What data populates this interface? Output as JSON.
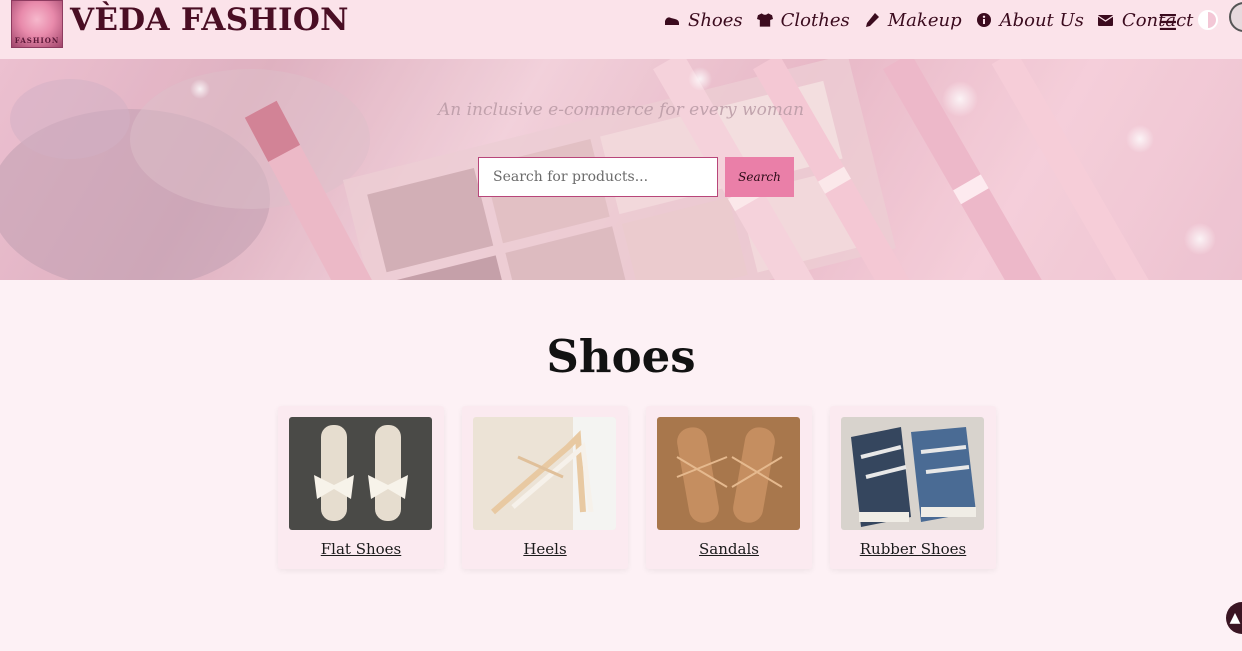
{
  "brand": {
    "name": "VÈDA FASHION",
    "logo_text": "FASHION"
  },
  "nav": {
    "items": [
      {
        "label": "Shoes",
        "icon": "shoe-icon"
      },
      {
        "label": "Clothes",
        "icon": "tshirt-icon"
      },
      {
        "label": "Makeup",
        "icon": "brush-icon"
      },
      {
        "label": "About Us",
        "icon": "info-icon"
      },
      {
        "label": "Contact",
        "icon": "envelope-icon"
      }
    ],
    "menu_glyph": "☰"
  },
  "hero": {
    "tagline": "An inclusive e-commerce for every woman",
    "search_placeholder": "Search for products...",
    "search_button": "Search"
  },
  "section": {
    "title": "Shoes",
    "cards": [
      {
        "label": "Flat Shoes"
      },
      {
        "label": "Heels"
      },
      {
        "label": "Sandals"
      },
      {
        "label": "Rubber Shoes"
      }
    ]
  },
  "colors": {
    "header_bg": "#fbe3ea",
    "page_bg": "#fdf1f5",
    "brand_text": "#4a0e24",
    "accent": "#ea7fa8"
  }
}
